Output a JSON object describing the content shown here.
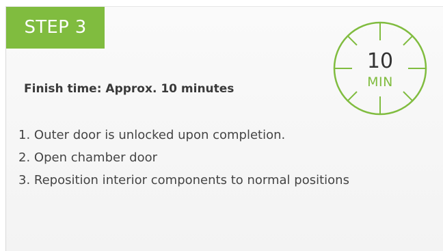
{
  "step": {
    "label": "STEP 3",
    "badge_color": "#80bc3f"
  },
  "finish_time": "Finish time: Approx. 10 minutes",
  "timer": {
    "icon": "stopwatch-icon",
    "number": "10",
    "unit": "MIN",
    "color": "#80bc3f"
  },
  "steps": [
    {
      "text": "1. Outer door is unlocked upon completion."
    },
    {
      "text": "2. Open chamber door"
    },
    {
      "text": "3. Reposition interior components to normal positions"
    }
  ]
}
